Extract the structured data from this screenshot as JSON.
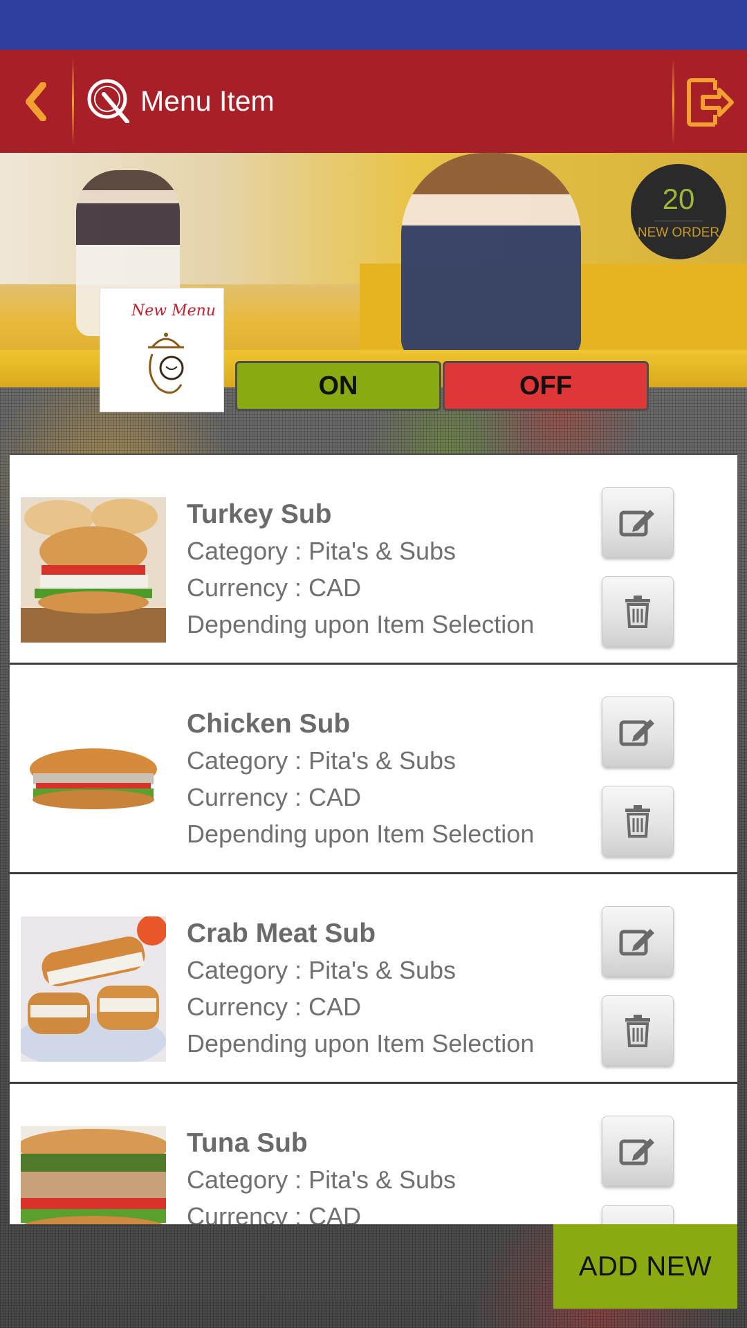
{
  "app_bar": {
    "title": "Menu Item",
    "back_icon": "chevron-left-icon",
    "logo_icon": "q-logo-icon",
    "logout_icon": "logout-icon"
  },
  "hero": {
    "new_order_count": "20",
    "new_order_label": "NEW ORDER",
    "menu_logo_text": "New Menu"
  },
  "toggle": {
    "on_label": "ON",
    "off_label": "OFF"
  },
  "items": [
    {
      "name": "Turkey Sub",
      "category": "Category : Pita's & Subs",
      "currency": "Currency : CAD",
      "price": "Depending upon Item Selection"
    },
    {
      "name": "Chicken Sub",
      "category": "Category : Pita's & Subs",
      "currency": "Currency : CAD",
      "price": "Depending upon Item Selection"
    },
    {
      "name": "Crab Meat Sub",
      "category": "Category : Pita's & Subs",
      "currency": "Currency : CAD",
      "price": "Depending upon Item Selection"
    },
    {
      "name": "Tuna Sub",
      "category": "Category : Pita's & Subs",
      "currency": "Currency : CAD"
    }
  ],
  "footer": {
    "add_new_label": "ADD NEW"
  },
  "colors": {
    "status_bar": "#2f3f9f",
    "app_bar": "#a81f27",
    "accent_orange": "#f2a030",
    "on_green": "#8aaa12",
    "off_red": "#df3638"
  }
}
